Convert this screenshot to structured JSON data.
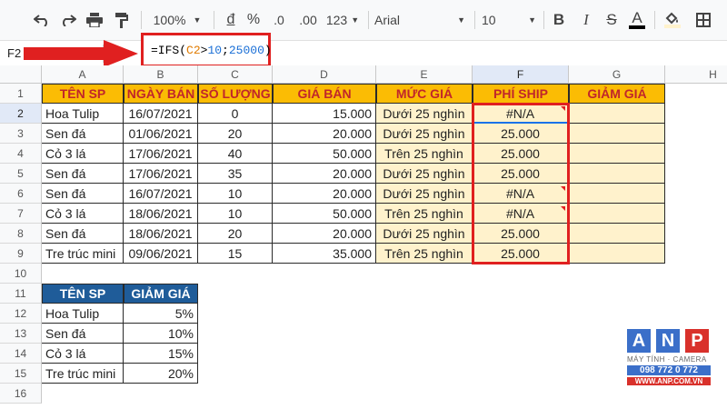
{
  "toolbar": {
    "zoom": "100%",
    "currency": "đ",
    "percent": "%",
    "dec_less": ".0",
    "dec_more": ".00",
    "number_format": "123",
    "font": "Arial",
    "font_size": "10",
    "bold": "B",
    "italic": "I",
    "strike": "S",
    "text_color": "A"
  },
  "formula_bar": {
    "cell_ref": "F2",
    "formula_prefix": "=IFS(",
    "formula_ref": "C2",
    "formula_op": ">",
    "formula_num1": "10",
    "formula_sep": ";",
    "formula_num2": "25000",
    "formula_suffix": ")"
  },
  "columns": [
    "A",
    "B",
    "C",
    "D",
    "E",
    "F",
    "G",
    "H"
  ],
  "rows": [
    "1",
    "2",
    "3",
    "4",
    "5",
    "6",
    "7",
    "8",
    "9",
    "10",
    "11",
    "12",
    "13",
    "14",
    "15",
    "16"
  ],
  "main_table": {
    "headers": [
      "TÊN SP",
      "NGÀY BÁN",
      "SỐ LƯỢNG",
      "GIÁ BÁN",
      "MỨC GIÁ",
      "PHÍ SHIP",
      "GIẢM GIÁ"
    ],
    "rows": [
      [
        "Hoa Tulip",
        "16/07/2021",
        "0",
        "15.000",
        "Dưới 25 nghìn",
        "#N/A",
        ""
      ],
      [
        "Sen đá",
        "01/06/2021",
        "20",
        "20.000",
        "Dưới 25 nghìn",
        "25.000",
        ""
      ],
      [
        "Cỏ 3 lá",
        "17/06/2021",
        "40",
        "50.000",
        "Trên 25 nghìn",
        "25.000",
        ""
      ],
      [
        "Sen đá",
        "17/06/2021",
        "35",
        "20.000",
        "Dưới 25 nghìn",
        "25.000",
        ""
      ],
      [
        "Sen đá",
        "16/07/2021",
        "10",
        "20.000",
        "Dưới 25 nghìn",
        "#N/A",
        ""
      ],
      [
        "Cỏ 3 lá",
        "18/06/2021",
        "10",
        "50.000",
        "Trên 25 nghìn",
        "#N/A",
        ""
      ],
      [
        "Sen đá",
        "18/06/2021",
        "20",
        "20.000",
        "Dưới 25 nghìn",
        "25.000",
        ""
      ],
      [
        "Tre trúc mini",
        "09/06/2021",
        "15",
        "35.000",
        "Trên 25 nghìn",
        "25.000",
        ""
      ]
    ]
  },
  "discount_table": {
    "headers": [
      "TÊN SP",
      "GIẢM GIÁ"
    ],
    "rows": [
      [
        "Hoa Tulip",
        "5%"
      ],
      [
        "Sen đá",
        "10%"
      ],
      [
        "Cỏ 3 lá",
        "15%"
      ],
      [
        "Tre trúc mini",
        "20%"
      ]
    ]
  },
  "watermark": {
    "letters": [
      "A",
      "N",
      "P"
    ],
    "tagline": "MÁY TÍNH · CAMERA",
    "phone": "098 772 0 772",
    "url": "WWW.ANP.COM.VN"
  },
  "colors": {
    "header_yellow": "#fbbc04",
    "header_text_red": "#c0262b",
    "body_yellow": "#fff2cc",
    "blue_header": "#1f5c99",
    "highlight_red": "#e02020",
    "anp_blue": "#3b6fc9",
    "anp_red": "#d9312b"
  }
}
